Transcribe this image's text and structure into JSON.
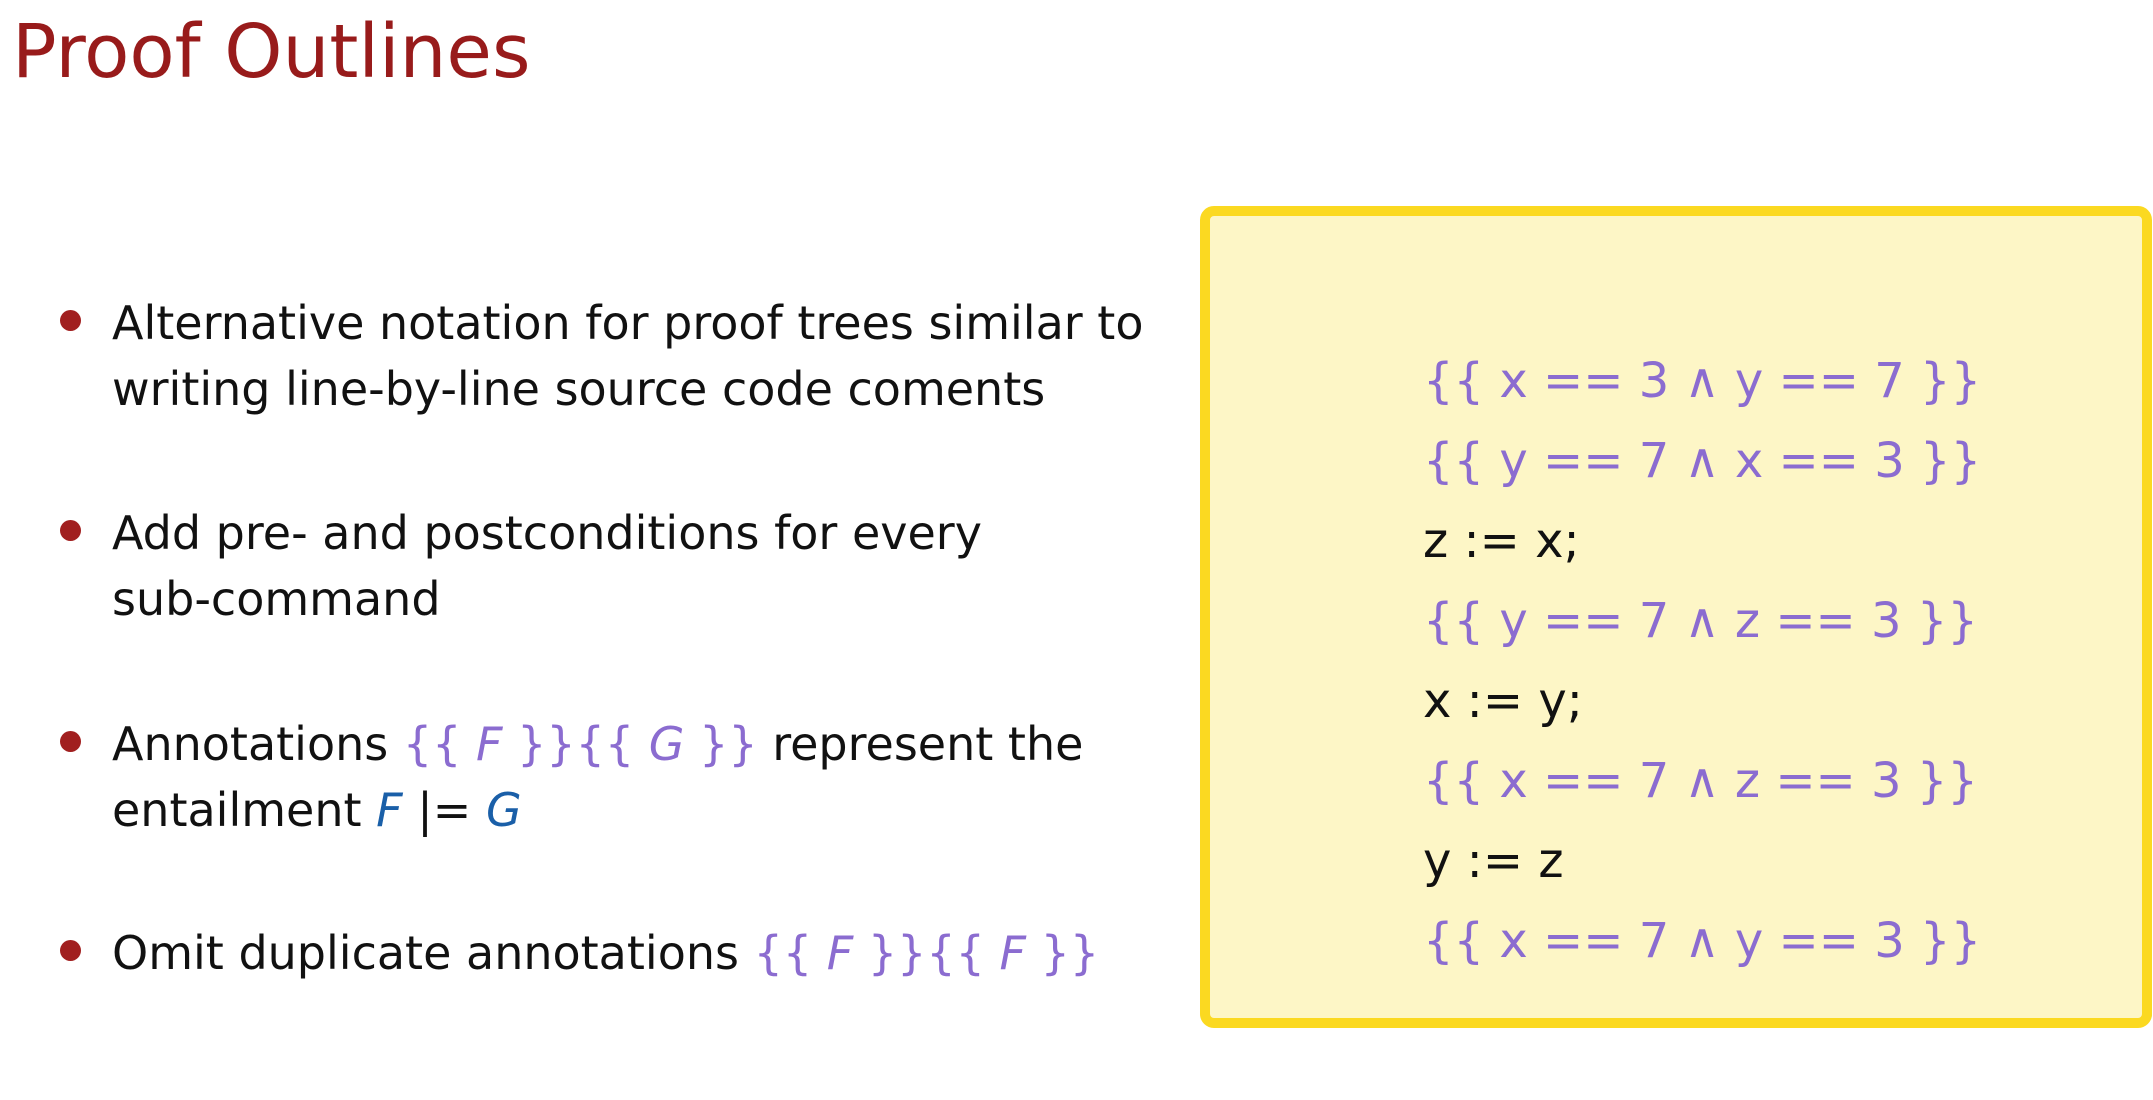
{
  "slide": {
    "title": "Proof Outlines"
  },
  "bullets": [
    {
      "lines": [
        "Alternative notation for proof trees similar to",
        "writing line-by-line source code coments"
      ]
    },
    {
      "lines": [
        "Add pre- and postconditions for every",
        "sub-command"
      ]
    },
    {
      "line1_before": "Annotations ",
      "annotation_open": "{{ ",
      "annotation_var_1": "F",
      "annotation_close": " }}",
      "annotation_open_2": "{{ ",
      "annotation_var_2": "G",
      "annotation_close_2": " }}",
      "line1_after": " represent the",
      "line2_before": "entailment ",
      "entail_left": "F",
      "models_symbol": " |= ",
      "entail_right": "G"
    },
    {
      "text": "Omit duplicate annotations ",
      "annotation_open": "{{ ",
      "annotation_var_1": "F",
      "annotation_close": " }}",
      "annotation_open_2": "{{ ",
      "annotation_var_2": "F",
      "annotation_close_2": " }}"
    }
  ],
  "code_box": {
    "lines": [
      {
        "kind": "assertion",
        "text": "{{ x == 3 ∧ y == 7 }}"
      },
      {
        "kind": "assertion",
        "text": "{{ y == 7 ∧ x == 3 }}"
      },
      {
        "kind": "command",
        "text": "z := x;"
      },
      {
        "kind": "assertion",
        "text": "{{ y == 7 ∧ z == 3 }}"
      },
      {
        "kind": "command",
        "text": "x := y;"
      },
      {
        "kind": "assertion",
        "text": "{{ x == 7 ∧ z == 3 }}"
      },
      {
        "kind": "command",
        "text": "y := z"
      },
      {
        "kind": "assertion",
        "text": "{{ x == 7 ∧ y == 3 }}"
      }
    ]
  },
  "colors": {
    "title": "#981b1b",
    "bullet": "#a11f1f",
    "annotation": "#8b6cd0",
    "entailment": "#1a5fa8",
    "box_border": "#fbd921",
    "box_fill": "#fdf6c6"
  }
}
